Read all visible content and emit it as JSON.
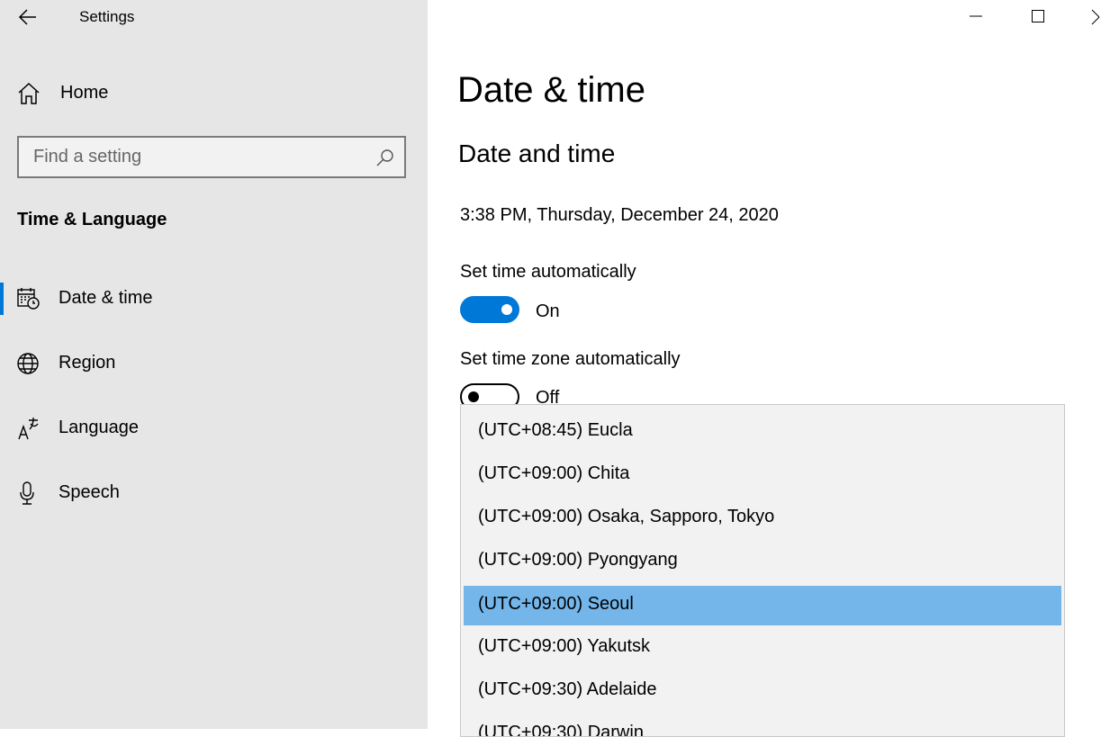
{
  "window": {
    "title": "Settings"
  },
  "sidebar": {
    "home_label": "Home",
    "search_placeholder": "Find a setting",
    "section_title": "Time & Language",
    "items": [
      {
        "label": "Date & time",
        "icon": "calendar-clock-icon"
      },
      {
        "label": "Region",
        "icon": "globe-icon"
      },
      {
        "label": "Language",
        "icon": "language-icon"
      },
      {
        "label": "Speech",
        "icon": "microphone-icon"
      }
    ]
  },
  "main": {
    "title": "Date & time",
    "section": "Date and time",
    "current_datetime": "3:38 PM, Thursday, December 24, 2020",
    "set_time_auto": {
      "label": "Set time automatically",
      "state": "On"
    },
    "set_timezone_auto": {
      "label": "Set time zone automatically",
      "state": "Off"
    }
  },
  "timezone_dropdown": {
    "options": [
      "(UTC+08:45) Eucla",
      "(UTC+09:00) Chita",
      "(UTC+09:00) Osaka, Sapporo, Tokyo",
      "(UTC+09:00) Pyongyang",
      "(UTC+09:00) Seoul",
      "(UTC+09:00) Yakutsk",
      "(UTC+09:30) Adelaide",
      "(UTC+09:30) Darwin"
    ],
    "selected": "(UTC+09:00) Seoul"
  },
  "colors": {
    "accent": "#0078d7",
    "sidebar_bg": "#e6e6e6",
    "dropdown_bg": "#f2f2f2",
    "selected_option_bg": "#74b6ea"
  }
}
